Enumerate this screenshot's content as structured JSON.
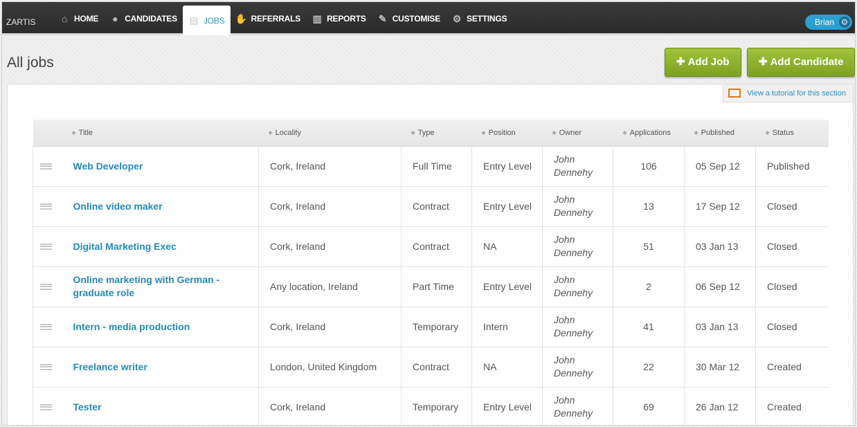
{
  "brand": "ZARTIS",
  "nav": [
    {
      "label": "HOME",
      "icon": "home-icon"
    },
    {
      "label": "CANDIDATES",
      "icon": "person-icon"
    },
    {
      "label": "JOBS",
      "icon": "document-icon",
      "active": true
    },
    {
      "label": "REFERRALS",
      "icon": "handshake-icon"
    },
    {
      "label": "REPORTS",
      "icon": "bar-chart-icon"
    },
    {
      "label": "CUSTOMISE",
      "icon": "brush-icon"
    },
    {
      "label": "SETTINGS",
      "icon": "gear-icon"
    }
  ],
  "user": {
    "name": "Brian"
  },
  "page_title": "All jobs",
  "buttons": {
    "add_job": "Add Job",
    "add_candidate": "Add Candidate"
  },
  "tutorial_link": "View a tutorial for this section",
  "table": {
    "columns": [
      "Title",
      "Locality",
      "Type",
      "Position",
      "Owner",
      "Applications",
      "Published",
      "Status"
    ],
    "rows": [
      {
        "title": "Web Developer",
        "locality": "Cork, Ireland",
        "type": "Full Time",
        "position": "Entry Level",
        "owner": "John Dennehy",
        "applications": "106",
        "published": "05 Sep 12",
        "status": "Published"
      },
      {
        "title": "Online video maker",
        "locality": "Cork, Ireland",
        "type": "Contract",
        "position": "Entry Level",
        "owner": "John Dennehy",
        "applications": "13",
        "published": "17 Sep 12",
        "status": "Closed"
      },
      {
        "title": "Digital Marketing Exec",
        "locality": "Cork, Ireland",
        "type": "Contract",
        "position": "NA",
        "owner": "John Dennehy",
        "applications": "51",
        "published": "03 Jan 13",
        "status": "Closed"
      },
      {
        "title": "Online marketing with German - graduate role",
        "locality": "Any location, Ireland",
        "type": "Part Time",
        "position": "Entry Level",
        "owner": "John Dennehy",
        "applications": "2",
        "published": "06 Sep 12",
        "status": "Closed"
      },
      {
        "title": "Intern - media production",
        "locality": "Cork, Ireland",
        "type": "Temporary",
        "position": "Intern",
        "owner": "John Dennehy",
        "applications": "41",
        "published": "03 Jan 13",
        "status": "Closed"
      },
      {
        "title": "Freelance writer",
        "locality": "London, United Kingdom",
        "type": "Contract",
        "position": "NA",
        "owner": "John Dennehy",
        "applications": "22",
        "published": "30 Mar 12",
        "status": "Created"
      },
      {
        "title": "Tester",
        "locality": "Cork, Ireland",
        "type": "Temporary",
        "position": "Entry Level",
        "owner": "John Dennehy",
        "applications": "69",
        "published": "26 Jan 12",
        "status": "Created"
      }
    ]
  },
  "colors": {
    "accent": "#2589b9",
    "button_green": "#8db32c",
    "topbar": "#333333",
    "user_pill": "#2a9fd0",
    "tutorial_icon": "#e07a1a"
  }
}
